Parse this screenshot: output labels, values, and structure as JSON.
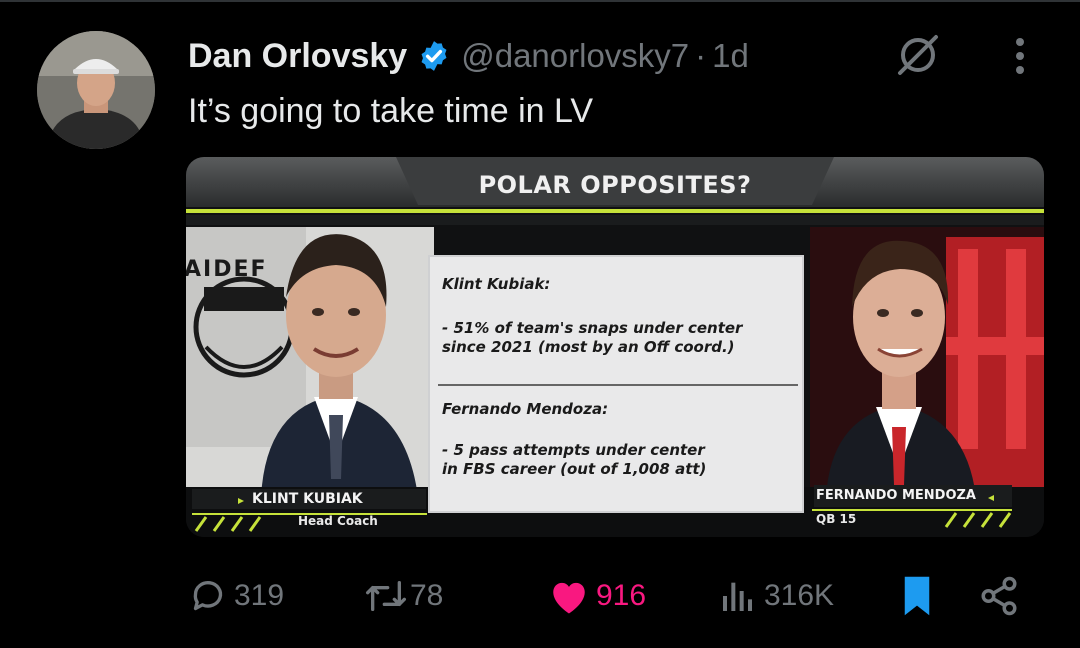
{
  "tweet": {
    "author_name": "Dan Orlovsky",
    "handle": "@danorlovsky7",
    "separator": "·",
    "time": "1d",
    "text": "It’s going to take time in LV"
  },
  "media": {
    "title": "POLAR OPPOSITES?",
    "left_sign_text": "AIDEF",
    "panel": {
      "heading1": "Klint Kubiak:",
      "bullet1_line1": "- 51% of team's snaps under center",
      "bullet1_line2": "since 2021 (most by an Off coord.)",
      "heading2": "Fernando Mendoza:",
      "bullet2_line1": "- 5 pass attempts under center",
      "bullet2_line2": "in FBS career (out of 1,008 att)"
    },
    "left_name": "KLINT KUBIAK",
    "left_sub": "Head Coach",
    "right_name": "FERNANDO MENDOZA",
    "right_sub": "QB 15"
  },
  "actions": {
    "replies": "319",
    "reposts": "78",
    "likes": "916",
    "views": "316K"
  },
  "colors": {
    "verified": "#1d9bf0",
    "like": "#f91880",
    "bookmark": "#1d9bf0",
    "muted": "#71767b",
    "accent_green": "#c6e23a"
  },
  "icons": [
    "verified-badge-icon",
    "grok-icon",
    "more-icon",
    "reply-icon",
    "repost-icon",
    "like-icon",
    "views-icon",
    "bookmark-icon",
    "share-icon"
  ]
}
